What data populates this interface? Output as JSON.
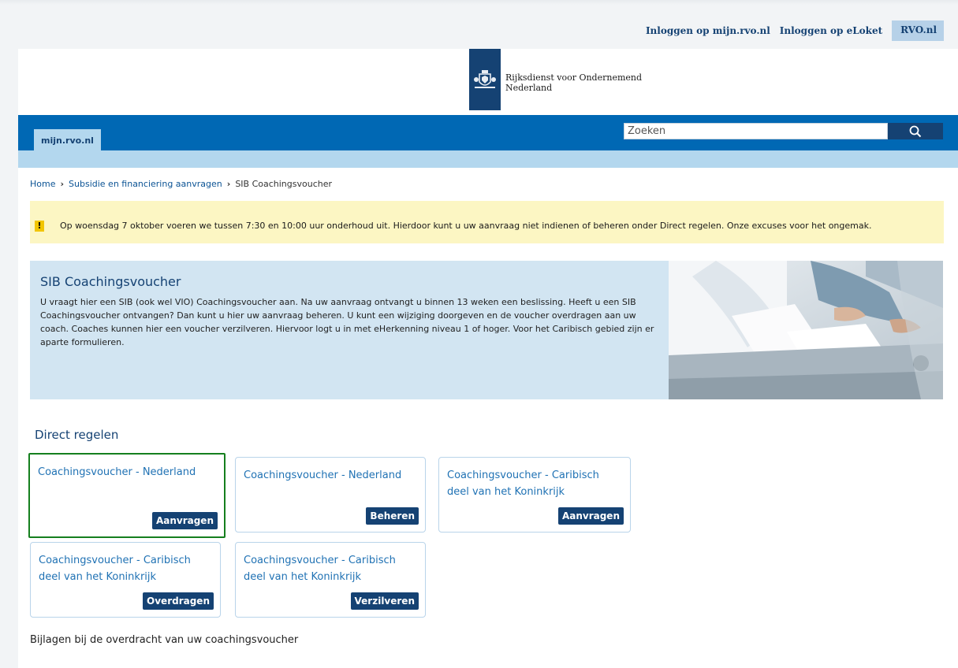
{
  "utility": {
    "links": [
      "Inloggen op mijn.rvo.nl",
      "Inloggen op eLoket"
    ],
    "rvo": "RVO.nl"
  },
  "logo": {
    "line1": "Rijksdienst voor Ondernemend",
    "line2": "Nederland"
  },
  "nav": {
    "tab": "mijn.rvo.nl",
    "search_placeholder": "Zoeken"
  },
  "breadcrumb": {
    "items": [
      "Home",
      "Subsidie en financiering aanvragen",
      "SIB Coachingsvoucher"
    ]
  },
  "alert": {
    "icon": "!",
    "text": "Op woensdag 7 oktober voeren we tussen 7:30 en 10:00 uur onderhoud uit. Hierdoor kunt u uw aanvraag niet indienen of beheren onder Direct regelen. Onze excuses voor het ongemak."
  },
  "intro": {
    "title": "SIB Coachingsvoucher",
    "body": "U vraagt hier een SIB (ook wel VIO) Coachingsvoucher aan. Na uw aanvraag ontvangt u binnen 13 weken een beslissing. Heeft u een SIB Coachingsvoucher ontvangen? Dan kunt u hier uw aanvraag beheren. U kunt een wijziging doorgeven en de voucher overdragen aan uw coach. Coaches kunnen hier een voucher verzilveren. Hiervoor logt u in met eHerkenning niveau 1 of hoger. Voor het Caribisch gebied zijn er aparte formulieren."
  },
  "direct": {
    "title": "Direct regelen",
    "cards": [
      {
        "title": "Coachingsvoucher - Nederland",
        "button": "Aanvragen"
      },
      {
        "title": "Coachingsvoucher - Nederland",
        "button": "Beheren"
      },
      {
        "title": "Coachingsvoucher - Caribisch deel van het Koninkrijk",
        "button": "Aanvragen"
      },
      {
        "title": "Coachingsvoucher - Caribisch deel van het Koninkrijk",
        "button": "Overdragen"
      },
      {
        "title": "Coachingsvoucher - Caribisch deel van het Koninkrijk",
        "button": "Verzilveren"
      }
    ]
  },
  "bijlagen": "Bijlagen bij de overdracht van uw coachingsvoucher",
  "colors": {
    "brand": "#154273",
    "nav": "#0068b4",
    "light_blue": "#b3d7ee",
    "alert": "#fcf6c3",
    "selected_border": "#157f1e"
  }
}
